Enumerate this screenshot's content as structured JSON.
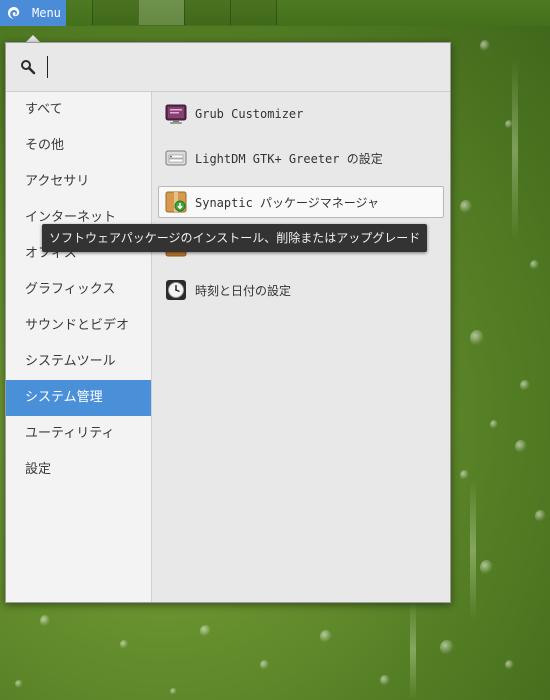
{
  "panel": {
    "menu_label": "Menu",
    "workspace_count": 5
  },
  "search": {
    "value": "",
    "placeholder": ""
  },
  "categories": [
    {
      "label": "すべて"
    },
    {
      "label": "その他"
    },
    {
      "label": "アクセサリ"
    },
    {
      "label": "インターネット"
    },
    {
      "label": "オフィス"
    },
    {
      "label": "グラフィックス"
    },
    {
      "label": "サウンドとビデオ"
    },
    {
      "label": "システムツール"
    },
    {
      "label": "システム管理",
      "selected": true
    },
    {
      "label": "ユーティリティ"
    },
    {
      "label": "設定"
    }
  ],
  "apps": [
    {
      "label": "Grub Customizer",
      "icon": "monitor-icon"
    },
    {
      "label": "LightDM GTK+ Greeter の設定",
      "icon": "login-screen-icon"
    },
    {
      "label": "Synaptic パッケージマネージャ",
      "icon": "package-icon",
      "hovered": true
    },
    {
      "label": "",
      "icon": "package-icon"
    },
    {
      "label": "時刻と日付の設定",
      "icon": "clock-icon"
    }
  ],
  "tooltip": {
    "text": "ソフトウェアパッケージのインストール、削除またはアップグレード"
  },
  "colors": {
    "accent": "#4a90d9",
    "menu_button": "#4a8cd8",
    "tooltip_bg": "#333333"
  }
}
